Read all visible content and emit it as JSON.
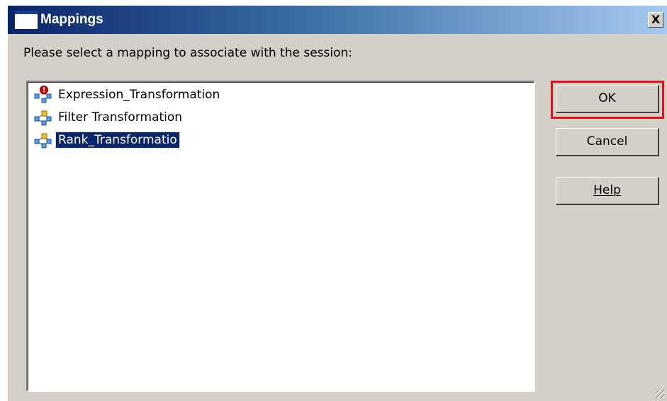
{
  "window": {
    "title": "Mappings",
    "close_label": "X"
  },
  "prompt": "Please select a mapping to associate with the session:",
  "mappings": [
    {
      "label": "Expression_Transformation",
      "icon": "mapping-invalid-icon",
      "selected": false
    },
    {
      "label": "Filter Transformation",
      "icon": "mapping-icon",
      "selected": false
    },
    {
      "label": "Rank_Transformatio",
      "icon": "mapping-icon",
      "selected": true
    }
  ],
  "buttons": {
    "ok": "OK",
    "cancel": "Cancel",
    "help": "Help"
  },
  "colors": {
    "titlebar_start": "#0a246a",
    "titlebar_end": "#a6caf0",
    "selection": "#0a246a",
    "highlight_outline": "#e01018",
    "dialog_bg": "#d4d0c8"
  }
}
